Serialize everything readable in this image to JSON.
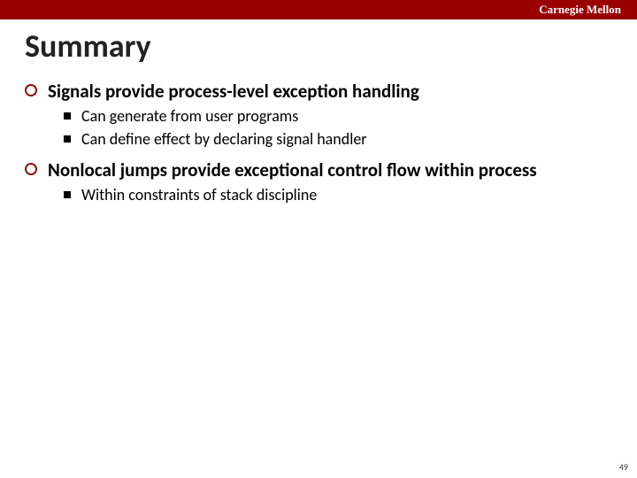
{
  "header": {
    "brand": "Carnegie Mellon"
  },
  "slide": {
    "title": "Summary",
    "items": [
      {
        "text": "Signals provide process-level exception handling",
        "sub": [
          "Can generate from user programs",
          "Can define effect by declaring signal handler"
        ]
      },
      {
        "text": "Nonlocal jumps provide exceptional control flow within process",
        "sub": [
          "Within constraints of stack discipline"
        ]
      }
    ],
    "page": "49"
  }
}
